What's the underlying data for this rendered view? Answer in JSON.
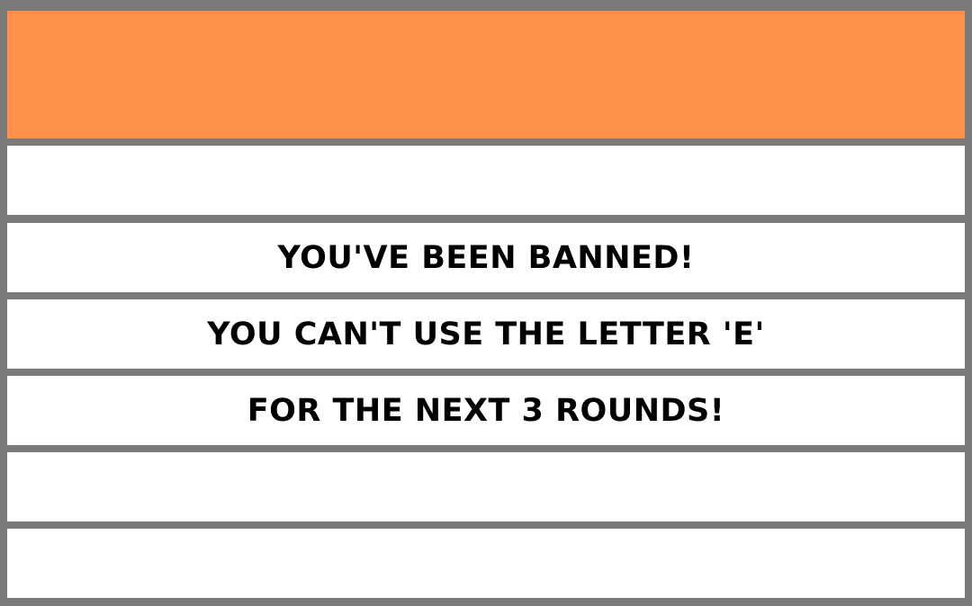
{
  "colors": {
    "header": "#ff914d",
    "frame": "#7a7a7a",
    "row_background": "#ffffff",
    "text": "#000000"
  },
  "card": {
    "header_text": "",
    "lines": [
      "",
      "YOU'VE BEEN BANNED!",
      "YOU CAN'T USE THE LETTER 'E'",
      "FOR THE NEXT 3 ROUNDS!",
      "",
      ""
    ]
  }
}
